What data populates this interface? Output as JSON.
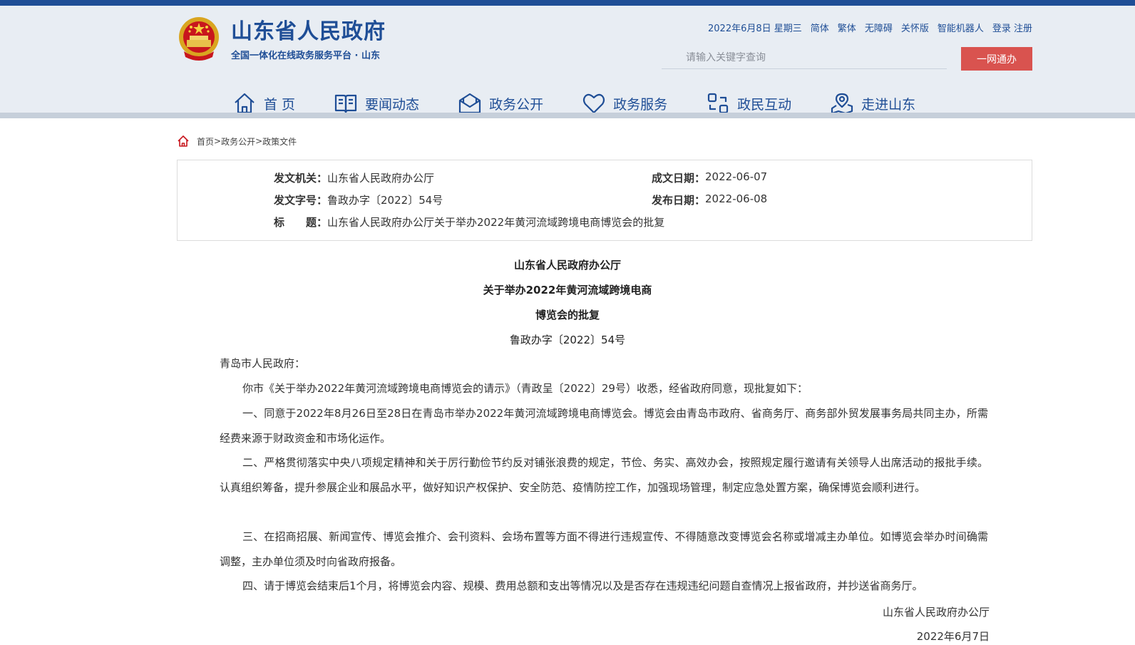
{
  "header": {
    "site_title": "山东省人民政府",
    "site_subtitle": "全国一体化在线政务服务平台 · 山东",
    "top_links": [
      "2022年6月8日 星期三",
      "简体",
      "繁体",
      "无障碍",
      "关怀版",
      "智能机器人",
      "登录 注册"
    ],
    "search_placeholder": "请输入关键字查询",
    "search_button": "一网通办",
    "brand_color": "#1f4e96",
    "accent_color": "#d9534f"
  },
  "nav": {
    "items": [
      {
        "label": "首 页",
        "icon": "home-icon"
      },
      {
        "label": "要闻动态",
        "icon": "book-icon"
      },
      {
        "label": "政务公开",
        "icon": "envelope-icon"
      },
      {
        "label": "政务服务",
        "icon": "heart-icon"
      },
      {
        "label": "政民互动",
        "icon": "interaction-icon"
      },
      {
        "label": "走进山东",
        "icon": "location-icon"
      }
    ]
  },
  "breadcrumb": {
    "items": [
      "首页",
      "政务公开",
      "政策文件"
    ],
    "separator": ">"
  },
  "meta": {
    "issuer_label": "发文机关：",
    "issuer": "山东省人民政府办公厅",
    "written_date_label": "成文日期：",
    "written_date": "2022-06-07",
    "doc_no_label": "发文字号：",
    "doc_no": "鲁政办字〔2022〕54号",
    "publish_date_label": "发布日期：",
    "publish_date": "2022-06-08",
    "title_label": "标　　题：",
    "title": "山东省人民政府办公厅关于举办2022年黄河流域跨境电商博览会的批复"
  },
  "document": {
    "title_lines": [
      "山东省人民政府办公厅",
      "关于举办2022年黄河流域跨境电商",
      "博览会的批复"
    ],
    "doc_no": "鲁政办字〔2022〕54号",
    "salutation": "青岛市人民政府：",
    "paragraphs": [
      "你市《关于举办2022年黄河流域跨境电商博览会的请示》（青政呈〔2022〕29号）收悉，经省政府同意，现批复如下：",
      "一、同意于2022年8月26日至28日在青岛市举办2022年黄河流域跨境电商博览会。博览会由青岛市政府、省商务厅、商务部外贸发展事务局共同主办，所需经费来源于财政资金和市场化运作。",
      "二、严格贯彻落实中央八项规定精神和关于厉行勤俭节约反对铺张浪费的规定，节俭、务实、高效办会，按照规定履行邀请有关领导人出席活动的报批手续。认真组织筹备，提升参展企业和展品水平，做好知识产权保护、安全防范、疫情防控工作，加强现场管理，制定应急处置方案，确保博览会顺利进行。",
      "三、在招商招展、新闻宣传、博览会推介、会刊资料、会场布置等方面不得进行违规宣传、不得随意改变博览会名称或增减主办单位。如博览会举办时间确需调整，主办单位须及时向省政府报备。",
      "四、请于博览会结束后1个月，将博览会内容、规模、费用总额和支出等情况以及是否存在违规违纪问题自查情况上报省政府，并抄送省商务厅。"
    ],
    "signature": "山东省人民政府办公厅",
    "sign_date": "2022年6月7日"
  }
}
